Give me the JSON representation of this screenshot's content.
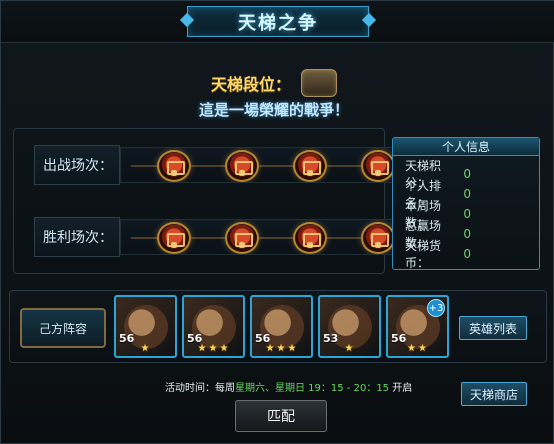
{
  "header": {
    "title": "天梯之争"
  },
  "rank": {
    "label": "天梯段位："
  },
  "subtitle": "這是一場榮耀的戰爭！",
  "rows": [
    {
      "label": "出战场次：",
      "chests": 4
    },
    {
      "label": "胜利场次：",
      "chests": 4
    }
  ],
  "personal_info": {
    "title": "个人信息",
    "items": [
      {
        "label": "天梯积分：",
        "value": "0"
      },
      {
        "label": "个人排名：",
        "value": "0"
      },
      {
        "label": "本周场数：",
        "value": "0"
      },
      {
        "label": "总赢场数：",
        "value": "0"
      },
      {
        "label": "天梯货币：",
        "value": "0"
      }
    ]
  },
  "team": {
    "title": "己方阵容",
    "heroes": [
      {
        "level": "56",
        "stars": 1
      },
      {
        "level": "56",
        "stars": 3
      },
      {
        "level": "56",
        "stars": 3
      },
      {
        "level": "53",
        "stars": 1
      },
      {
        "level": "56",
        "stars": 2,
        "badge": "+3"
      }
    ],
    "heroes_button": "英雄列表"
  },
  "schedule": {
    "prefix": "活动时间：每周",
    "day1": "星期六",
    "sep": "、",
    "day2": "星期日",
    "time": " 19：15 - 20：15 ",
    "suffix": "开启"
  },
  "buttons": {
    "shop": "天梯商店",
    "match": "匹配"
  }
}
